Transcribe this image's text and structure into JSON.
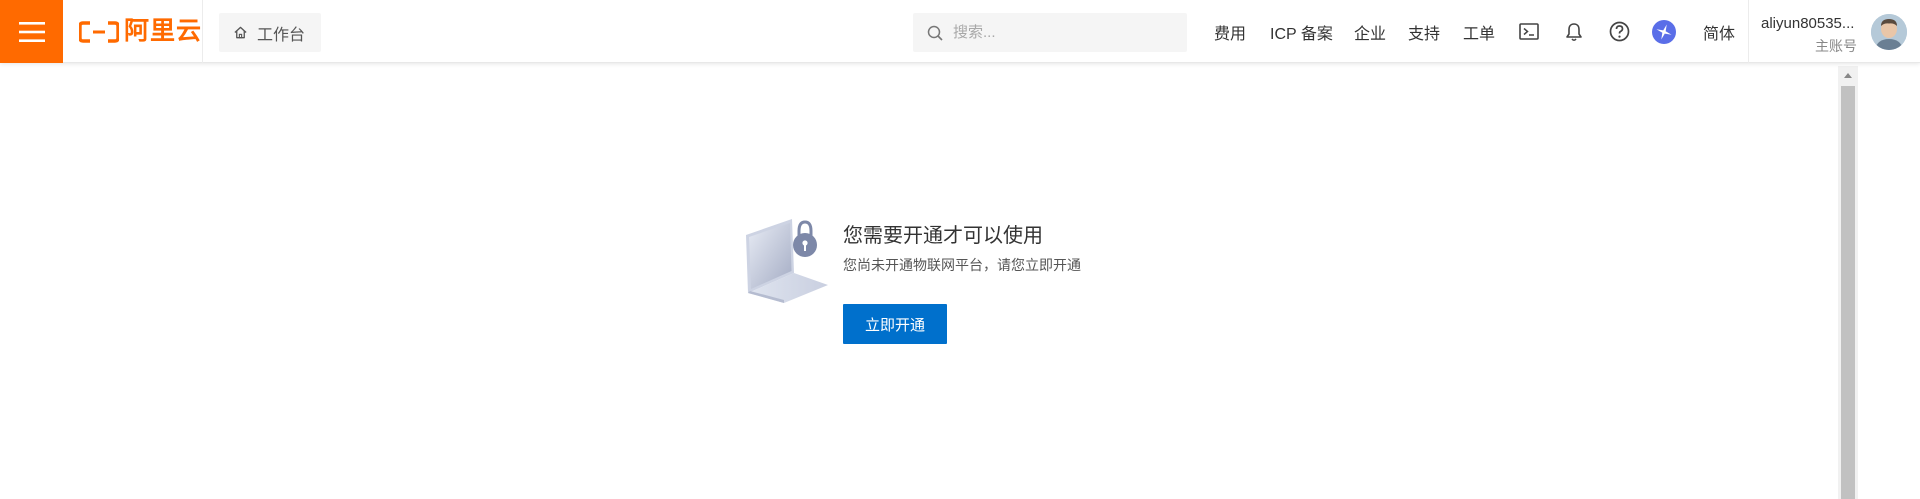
{
  "header": {
    "logo_text": "阿里云",
    "workbench_label": "工作台",
    "search": {
      "placeholder": "搜索...",
      "value": ""
    },
    "nav": {
      "fees": "费用",
      "icp": "ICP 备案",
      "enterprise": "企业",
      "support": "支持",
      "tickets": "工单",
      "language": "简体"
    },
    "icons": [
      "menu-icon",
      "home-icon",
      "search-icon",
      "terminal-icon",
      "bell-icon",
      "help-icon",
      "app-switch-icon"
    ],
    "user": {
      "name": "aliyun80535...",
      "role": "主账号"
    }
  },
  "empty_state": {
    "title": "您需要开通才可以使用",
    "description": "您尚未开通物联网平台，请您立即开通",
    "button_label": "立即开通"
  },
  "colors": {
    "brand_orange": "#ff6a00",
    "primary_blue": "#0070cc",
    "app_icon_blue": "#5a6ee8"
  }
}
